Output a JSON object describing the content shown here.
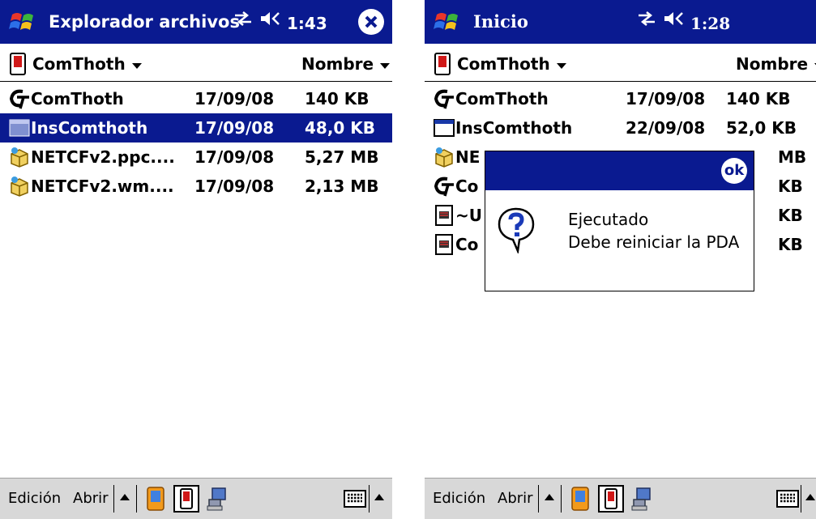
{
  "left": {
    "title": "Explorador archivos",
    "time": "1:43",
    "folder": "ComThoth",
    "sort": "Nombre",
    "files": [
      {
        "name": "ComThoth",
        "date": "17/09/08",
        "size": "140 KB",
        "icon": "ct-logo-icon",
        "selected": false
      },
      {
        "name": "InsComthoth",
        "date": "17/09/08",
        "size": "48,0 KB",
        "icon": "generic-file-icon",
        "selected": true
      },
      {
        "name": "NETCFv2.ppc....",
        "date": "17/09/08",
        "size": "5,27 MB",
        "icon": "cab-package-icon",
        "selected": false
      },
      {
        "name": "NETCFv2.wm....",
        "date": "17/09/08",
        "size": "2,13 MB",
        "icon": "cab-package-icon",
        "selected": false
      }
    ],
    "menu": {
      "edit": "Edición",
      "open": "Abrir"
    }
  },
  "right": {
    "title": "Inicio",
    "time": "1:28",
    "folder": "ComThoth",
    "sort": "Nombre",
    "files": [
      {
        "name": "ComThoth",
        "date": "17/09/08",
        "size": "140 KB",
        "icon": "ct-logo-icon"
      },
      {
        "name": "InsComthoth",
        "date": "22/09/08",
        "size": "52,0 KB",
        "icon": "window-app-icon"
      },
      {
        "name": "NE",
        "date": "",
        "size": "MB",
        "icon": "cab-package-icon"
      },
      {
        "name": "Co",
        "date": "",
        "size": "KB",
        "icon": "ct-logo-icon"
      },
      {
        "name": "~U",
        "date": "",
        "size": "KB",
        "icon": "text-document-icon"
      },
      {
        "name": "Co",
        "date": "",
        "size": "KB",
        "icon": "text-document-icon"
      }
    ],
    "dialog": {
      "ok": "ok",
      "line1": "Ejecutado",
      "line2": "Debe reiniciar la PDA"
    },
    "menu": {
      "edit": "Edición",
      "open": "Abrir"
    }
  },
  "colors": {
    "titlebar": "#0a1a90",
    "selection": "#0a1a90",
    "menubar": "#d8d8d8"
  }
}
